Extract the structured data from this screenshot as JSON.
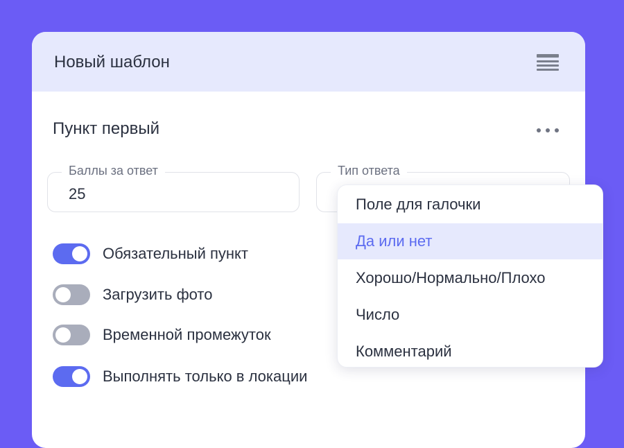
{
  "colors": {
    "background": "#6b5cf5",
    "header_bg": "#e6e9fd",
    "accent": "#5c6bf0",
    "toggle_off": "#a9adbb"
  },
  "card": {
    "title": "Новый шаблон",
    "menu_icon": "hamburger-menu-icon"
  },
  "item": {
    "title": "Пункт первый",
    "more_icon": "more-dots-icon",
    "score_field": {
      "label": "Баллы за ответ",
      "value": "25"
    },
    "answer_type_field": {
      "label": "Тип ответа",
      "value": ""
    },
    "toggles": [
      {
        "label": "Обязательный пункт",
        "on": true
      },
      {
        "label": "Загрузить фото",
        "on": false
      },
      {
        "label": "Временной промежуток",
        "on": false
      },
      {
        "label": "Выполнять только в локации",
        "on": true
      }
    ]
  },
  "dropdown": {
    "selected_index": 1,
    "options": [
      "Поле для галочки",
      "Да или нет",
      "Хорошо/Нормально/Плохо",
      "Число",
      "Комментарий"
    ]
  }
}
